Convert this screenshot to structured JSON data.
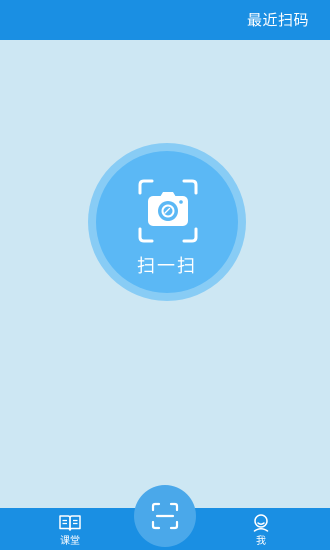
{
  "header": {
    "action_label": "最近扫码"
  },
  "scan": {
    "label": "扫一扫",
    "icon": "camera-scan-icon"
  },
  "bottom_nav": {
    "items": [
      {
        "label": "课堂",
        "icon": "book-icon"
      },
      {
        "label": "我",
        "icon": "user-icon"
      }
    ],
    "center_icon": "scan-frame-icon"
  },
  "colors": {
    "primary": "#1a8fe3",
    "background": "#cde7f3",
    "scan_outer": "#88ccf5",
    "scan_inner": "#5bb8f5"
  }
}
